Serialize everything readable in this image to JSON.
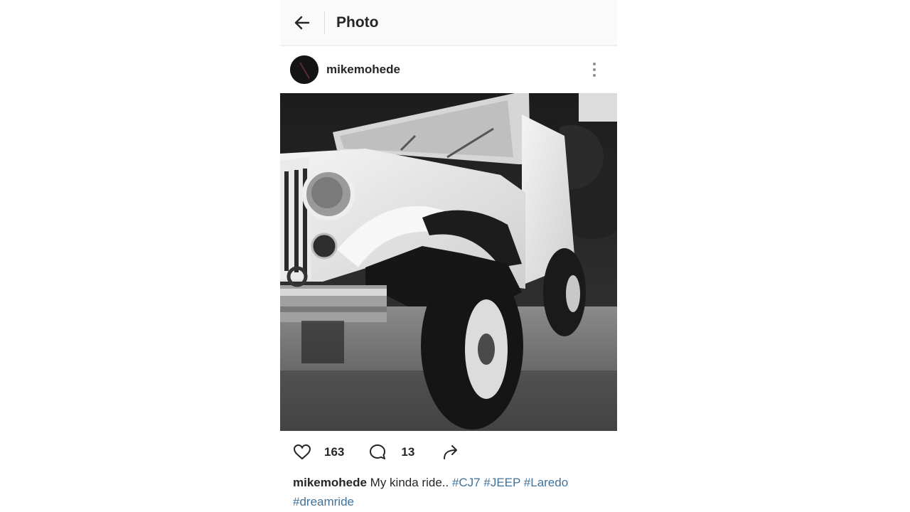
{
  "header": {
    "back_icon": "arrow-left-icon",
    "title": "Photo"
  },
  "post": {
    "username": "mikemohede",
    "more_icon": "vertical-dots-icon",
    "photo_alt": "mikemohede photo",
    "likes": "163",
    "comments": "13",
    "caption": {
      "username": "mikemohede",
      "text": "My kinda ride..",
      "hashtags": [
        "#CJ7",
        "#JEEP",
        "#Laredo",
        "#dreamride"
      ]
    }
  },
  "colors": {
    "hashtag": "#3f729b",
    "text": "#262626",
    "topbar": "#fafafa"
  }
}
